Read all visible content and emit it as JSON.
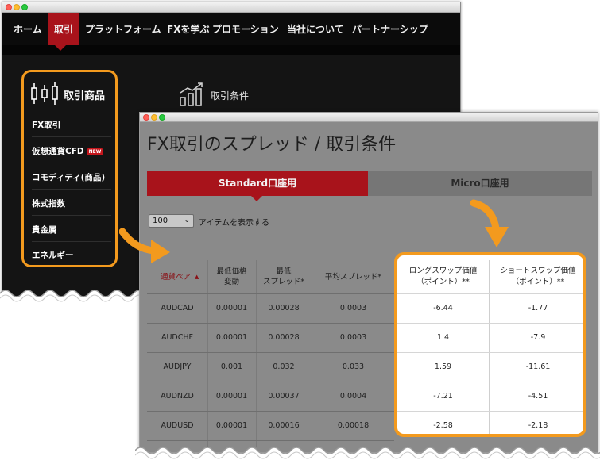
{
  "back_window": {
    "nav": [
      "ホーム",
      "取引",
      "プラットフォーム",
      "FXを学ぶ",
      "プロモーション",
      "当社について",
      "パートナーシップ"
    ],
    "menu_title": "取引商品",
    "menu_items": [
      "FX取引",
      "仮想通貨CFD",
      "コモディティ(商品)",
      "株式指数",
      "貴金属",
      "エネルギー"
    ],
    "new_badge": "NEW",
    "conditions_title": "取引条件"
  },
  "front_window": {
    "title": "FX取引のスプレッド / 取引条件",
    "tabs": [
      "Standard口座用",
      "Micro口座用"
    ],
    "page_size": "100",
    "page_size_label": "アイテムを表示する",
    "headers": {
      "pair": "通貨ペア",
      "min_step": "最低価格\n変動",
      "min_spread": "最低\nスプレッド*",
      "avg_spread": "平均スプレッド*",
      "long_swap": "ロングスワップ価値\n（ポイント）**",
      "short_swap": "ショートスワップ価値\n（ポイント）**"
    },
    "rows": [
      {
        "pair": "AUDCAD",
        "min_step": "0.00001",
        "min_spread": "0.00028",
        "avg_spread": "0.0003",
        "long_swap": "-6.44",
        "short_swap": "-1.77"
      },
      {
        "pair": "AUDCHF",
        "min_step": "0.00001",
        "min_spread": "0.00028",
        "avg_spread": "0.0003",
        "long_swap": "1.4",
        "short_swap": "-7.9"
      },
      {
        "pair": "AUDJPY",
        "min_step": "0.001",
        "min_spread": "0.032",
        "avg_spread": "0.033",
        "long_swap": "1.59",
        "short_swap": "-11.61"
      },
      {
        "pair": "AUDNZD",
        "min_step": "0.00001",
        "min_spread": "0.00037",
        "avg_spread": "0.0004",
        "long_swap": "-7.21",
        "short_swap": "-4.51"
      },
      {
        "pair": "AUDUSD",
        "min_step": "0.00001",
        "min_spread": "0.00016",
        "avg_spread": "0.00018",
        "long_swap": "-2.58",
        "short_swap": "-2.18"
      }
    ]
  },
  "colors": {
    "accent_red": "#a8131b",
    "highlight_orange": "#f39a1e",
    "dark_bg": "#141414"
  }
}
